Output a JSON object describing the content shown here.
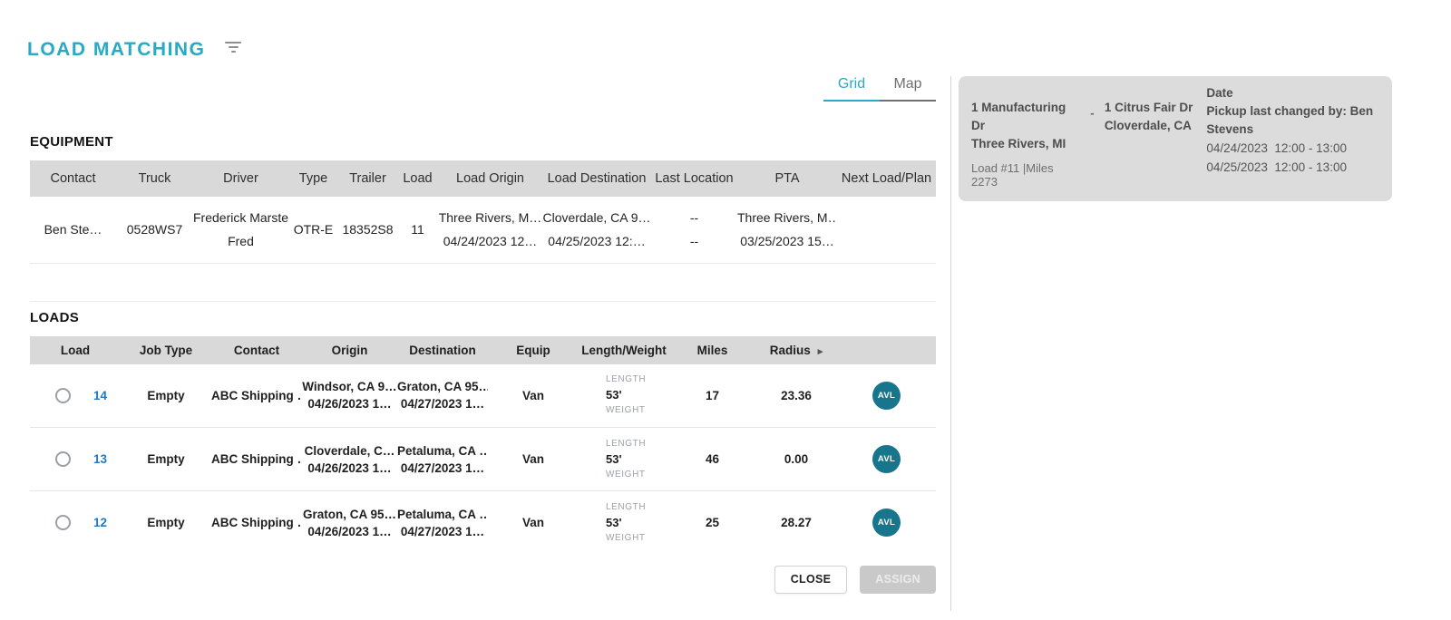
{
  "app": {
    "title": "LOAD MATCHING"
  },
  "colors": {
    "accent": "#29a9c4",
    "badge_teal": "#17768b",
    "link_blue": "#2079c8",
    "header_gray": "#d9d9d9"
  },
  "tabs": {
    "grid": "Grid",
    "map": "Map"
  },
  "equipment": {
    "section_title": "EQUIPMENT",
    "columns": [
      "Contact",
      "Truck",
      "Driver",
      "Type",
      "Trailer",
      "Load",
      "Load Origin",
      "Load Destination",
      "Last Location",
      "PTA",
      "Next Load/Plan"
    ],
    "row": {
      "contact": "Ben Ste…",
      "truck": "0528WS7",
      "driver_line1": "Frederick Marste",
      "driver_line2": "Fred",
      "type": "OTR-E",
      "trailer": "18352S8",
      "load": "11",
      "origin_line1": "Three Rivers, M…",
      "origin_line2": "04/24/2023 12…",
      "destination_line1": "Cloverdale, CA 9…",
      "destination_line2": "04/25/2023 12:…",
      "last_location_line1": "--",
      "last_location_line2": "--",
      "pta_line1": "Three Rivers, M…",
      "pta_line2": "03/25/2023 15…",
      "next_load_plan": ""
    }
  },
  "loads": {
    "section_title": "LOADS",
    "columns": [
      "Load",
      "Job Type",
      "Contact",
      "Origin",
      "Destination",
      "Equip",
      "Length/Weight",
      "Miles",
      "Radius"
    ],
    "length_label": "LENGTH",
    "weight_label": "WEIGHT",
    "rows": [
      {
        "load_id": "14",
        "job_type": "Empty",
        "contact": "ABC Shipping …",
        "origin_line1": "Windsor, CA 9…",
        "origin_line2": "04/26/2023 1…",
        "dest_line1": "Graton, CA 95…",
        "dest_line2": "04/27/2023 1…",
        "equip": "Van",
        "length": "53'",
        "miles": "17",
        "radius": "23.36",
        "badge": "AVL"
      },
      {
        "load_id": "13",
        "job_type": "Empty",
        "contact": "ABC Shipping …",
        "origin_line1": "Cloverdale, C…",
        "origin_line2": "04/26/2023 1…",
        "dest_line1": "Petaluma, CA …",
        "dest_line2": "04/27/2023 1…",
        "equip": "Van",
        "length": "53'",
        "miles": "46",
        "radius": "0.00",
        "badge": "AVL"
      },
      {
        "load_id": "12",
        "job_type": "Empty",
        "contact": "ABC Shipping …",
        "origin_line1": "Graton, CA 95…",
        "origin_line2": "04/26/2023 1…",
        "dest_line1": "Petaluma, CA …",
        "dest_line2": "04/27/2023 1…",
        "equip": "Van",
        "length": "53'",
        "miles": "25",
        "radius": "28.27",
        "badge": "AVL"
      }
    ]
  },
  "footer": {
    "close_label": "CLOSE",
    "assign_label": "ASSIGN"
  },
  "detail_card": {
    "origin_address_line1": "1 Manufacturing Dr",
    "origin_address_line2": "Three Rivers, MI",
    "separator": "-",
    "dest_address_line1": "1 Citrus Fair Dr",
    "dest_address_line2": "Cloverdale, CA",
    "load_miles": "Load #11 |Miles 2273",
    "date_label": "Date",
    "pickup_changed_by": "Pickup last changed by: Ben Stevens",
    "date_range_1": "04/24/2023  12:00 - 13:00",
    "date_range_2": "04/25/2023  12:00 - 13:00"
  }
}
